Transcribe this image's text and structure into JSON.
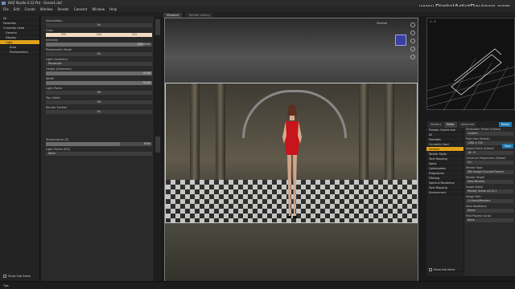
{
  "window": {
    "title": "DAZ Studio 4.12 Pro - Scene1.duf"
  },
  "brand": "www.DigitalArtistReviews.com",
  "menu": [
    "File",
    "Edit",
    "Create",
    "Window",
    "Render",
    "Connect",
    "Window",
    "Help"
  ],
  "left_panel": {
    "items": [
      "All",
      "Favorites",
      "Currently Used"
    ],
    "tree": [
      "General",
      "Display",
      "Light",
      "Area",
      "Photometrics"
    ],
    "selected": "Light",
    "footer": "Show Sub Items"
  },
  "properties": {
    "illumination": {
      "label": "Illumination",
      "value": "On"
    },
    "color": {
      "label": "Color",
      "r": "255",
      "g": "244",
      "b": "211"
    },
    "intensity": {
      "label": "Intensity",
      "value": "10000.0%"
    },
    "photometric_mode": {
      "label": "Photometric Mode",
      "value": "On"
    },
    "light_geometry": {
      "label": "Light Geometry",
      "value": "Rectangle"
    },
    "height": {
      "label": "Height (Diameter)",
      "value": "30.00"
    },
    "width": {
      "label": "Width",
      "value": "30.00"
    },
    "light_portal": {
      "label": "Light Portal",
      "value": "Off"
    },
    "two_sided": {
      "label": "Two Sided",
      "value": "Off"
    },
    "render_emitter": {
      "label": "Render Emitter",
      "value": "On"
    },
    "temperature": {
      "label": "Temperature (K)",
      "value": "6500"
    },
    "light_profile": {
      "label": "Light Profile (IES)",
      "value": "None"
    }
  },
  "viewport": {
    "tabs": [
      "Viewport",
      "Render Library"
    ],
    "camera": "General",
    "label": "Perspective View"
  },
  "aux_viewport": {
    "label": "1 : 1"
  },
  "render_settings": {
    "tabs": [
      "Shaders",
      "Editor",
      "Advanced"
    ],
    "badge": "Ready",
    "preset_label": "Presets",
    "preset_value": "Hybrid new",
    "items": [
      "All",
      "Favorites",
      "Currently Used",
      "General",
      "Render Mode",
      "Tone Mapping",
      "Alpha",
      "Optimization",
      "Progressive",
      "Filtering",
      "Spectral Rendering",
      "Tone Mapping",
      "Environment"
    ],
    "selected": "General",
    "fields": [
      {
        "label": "Dimension Preset (Global)",
        "value": "Custom"
      },
      {
        "label": "Pixel Size (Global)",
        "value": "1280 x 720"
      },
      {
        "label": "Aspect Ratio (Global)",
        "value": "16 : 9"
      },
      {
        "label": "Constrain Proportions (Global)",
        "value": "On"
      },
      {
        "label": "Render Type",
        "value": "Still Image (Current Frame)"
      },
      {
        "label": "Render Target",
        "value": "New Window"
      },
      {
        "label": "Image Name",
        "value": "Render Scene v4.12.1"
      },
      {
        "label": "Image Path",
        "value": "C:/Users/Renders"
      },
      {
        "label": "Auto Headlamp",
        "value": "Never"
      },
      {
        "label": "Post Process Script",
        "value": "None"
      }
    ],
    "save_label": "Save",
    "footer": "Show Sub Items"
  },
  "status": {
    "text": "Tips"
  }
}
